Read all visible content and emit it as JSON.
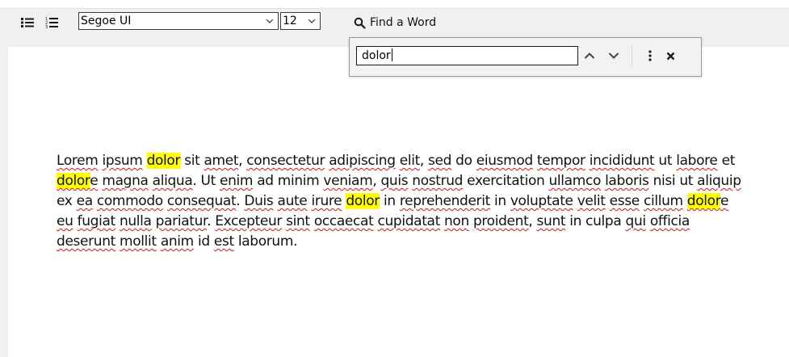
{
  "toolbar": {
    "font_name": "Segoe UI",
    "font_size": "12",
    "find_label": "Find a Word",
    "icons": [
      "unordered-list-icon",
      "ordered-list-icon",
      "search-icon",
      "chevron-down-icon"
    ]
  },
  "find_panel": {
    "query": "dolor",
    "icons": [
      "chevron-up-icon",
      "chevron-down-icon",
      "more-vertical-icon",
      "close-icon"
    ]
  },
  "document": {
    "highlight_color": "#ffff00",
    "spell_error_color": "#e01010",
    "paragraph": "Lorem ipsum dolor sit amet, consectetur adipiscing elit, sed do eiusmod tempor incididunt ut labore et dolore magna aliqua. Ut enim ad minim veniam, quis nostrud exercitation ullamco laboris nisi ut aliquip ex ea commodo consequat. Duis aute irure dolor in reprehenderit in voluptate velit esse cillum dolore eu fugiat nulla pariatur. Excepteur sint occaecat cupidatat non proident, sunt in culpa qui officia deserunt mollit anim id est laborum.",
    "misspelled": [
      "Lorem",
      "ipsum",
      "amet",
      "consectetur",
      "adipiscing",
      "elit",
      "sed",
      "eiusmod",
      "tempor",
      "incididunt",
      "labore",
      "dolore",
      "magna",
      "aliqua",
      "enim",
      "veniam",
      "quis",
      "nostrud",
      "ullamco",
      "laboris",
      "aliquip",
      "ea",
      "commodo",
      "consequat",
      "Duis",
      "aute",
      "irure",
      "reprehenderit",
      "voluptate",
      "velit",
      "esse",
      "cillum",
      "eu",
      "fugiat",
      "nulla",
      "pariatur",
      "Excepteur",
      "sint",
      "occaecat",
      "cupidatat",
      "non",
      "proident",
      "sunt",
      "qui",
      "officia",
      "deserunt",
      "mollit",
      "anim",
      "est"
    ]
  }
}
